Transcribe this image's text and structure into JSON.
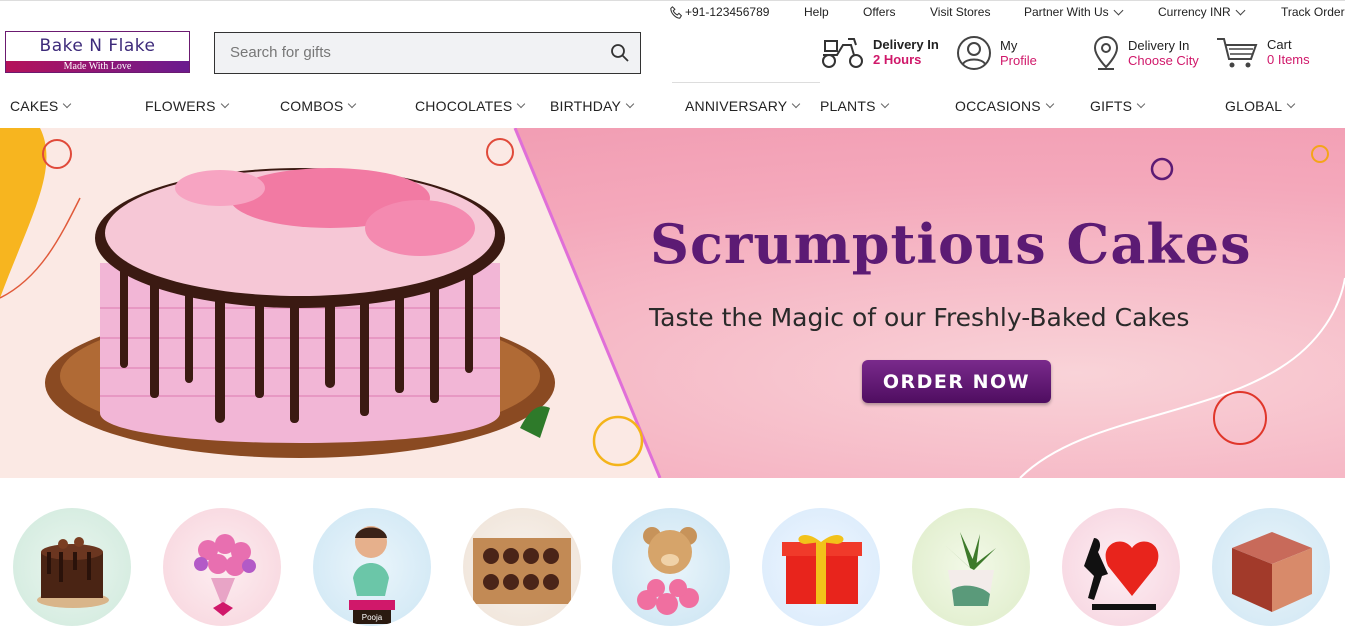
{
  "topbar": {
    "phone": "+91-123456789",
    "help": "Help",
    "offers": "Offers",
    "visit_stores": "Visit Stores",
    "partner": "Partner With Us",
    "currency": "Currency INR",
    "track": "Track Order"
  },
  "logo": {
    "name": "Bake N Flake",
    "tagline": "Made With Love"
  },
  "search": {
    "placeholder": "Search for gifts"
  },
  "header": {
    "delivery": {
      "line1": "Delivery In",
      "line2": "2 Hours"
    },
    "profile": {
      "line1": "My",
      "line2": "Profile"
    },
    "city": {
      "line1": "Delivery In",
      "line2": "Choose City"
    },
    "cart": {
      "line1": "Cart",
      "line2": "0 Items"
    }
  },
  "nav": [
    "CAKES",
    "FLOWERS",
    "COMBOS",
    "CHOCOLATES",
    "BIRTHDAY",
    "ANNIVERSARY",
    "PLANTS",
    "OCCASIONS",
    "GIFTS",
    "GLOBAL"
  ],
  "banner": {
    "title": "Scrumptious Cakes",
    "subtitle": "Taste the Magic of our Freshly-Baked Cakes",
    "cta": "ORDER NOW"
  },
  "colors": {
    "brand_purple": "#5c1b74",
    "accent_pink": "#d0186a",
    "banner_pink": "#f4a8bb"
  },
  "categories": [
    "cake-icon",
    "flowers-icon",
    "personalized-icon",
    "chocolates-icon",
    "teddy-icon",
    "gift-box-icon",
    "plant-icon",
    "anniversary-icon",
    "photo-cube-icon"
  ],
  "caricature_name": "Pooja"
}
